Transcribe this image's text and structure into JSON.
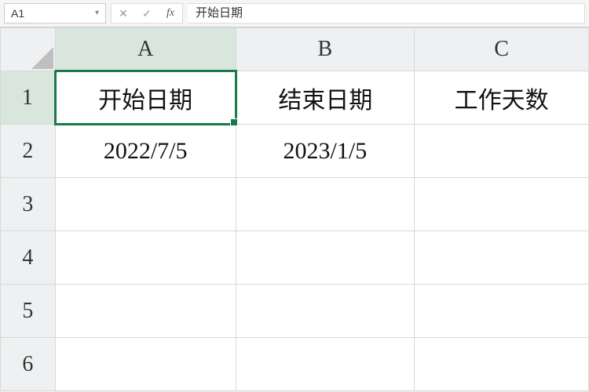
{
  "formula_bar": {
    "name_box": "A1",
    "cancel_glyph": "✕",
    "confirm_glyph": "✓",
    "fx_label": "fx",
    "formula_value": "开始日期"
  },
  "columns": [
    "A",
    "B",
    "C"
  ],
  "rows": [
    "1",
    "2",
    "3",
    "4",
    "5",
    "6"
  ],
  "active_cell": "A1",
  "cells": {
    "A1": "开始日期",
    "B1": "结束日期",
    "C1": "工作天数",
    "A2": "2022/7/5",
    "B2": "2023/1/5",
    "C2": "",
    "A3": "",
    "B3": "",
    "C3": "",
    "A4": "",
    "B4": "",
    "C4": "",
    "A5": "",
    "B5": "",
    "C5": "",
    "A6": "",
    "B6": "",
    "C6": ""
  }
}
